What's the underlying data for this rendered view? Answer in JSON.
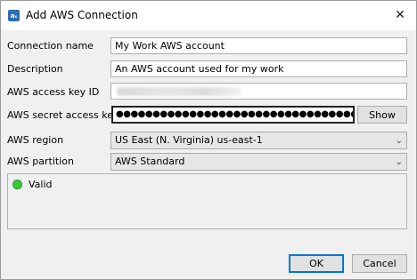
{
  "window": {
    "title": "Add AWS Connection",
    "app_icon_text": "aₓ",
    "close_glyph": "✕"
  },
  "form": {
    "connection_name": {
      "label": "Connection name",
      "value": "My Work AWS account"
    },
    "description": {
      "label": "Description",
      "value": "An AWS account used for my work"
    },
    "access_key_id": {
      "label": "AWS access key ID",
      "value": ""
    },
    "secret_access_key": {
      "label": "AWS secret access key",
      "value": "●●●●●●●●●●●●●●●●●●●●●●●●●●●●●●●●●●●●●●●●",
      "show_label": "Show"
    },
    "region": {
      "label": "AWS region",
      "value": "US East (N. Virginia) us-east-1"
    },
    "partition": {
      "label": "AWS partition",
      "value": "AWS Standard"
    }
  },
  "status": {
    "text": "Valid",
    "color": "#3ec83e"
  },
  "buttons": {
    "ok": "OK",
    "cancel": "Cancel"
  }
}
